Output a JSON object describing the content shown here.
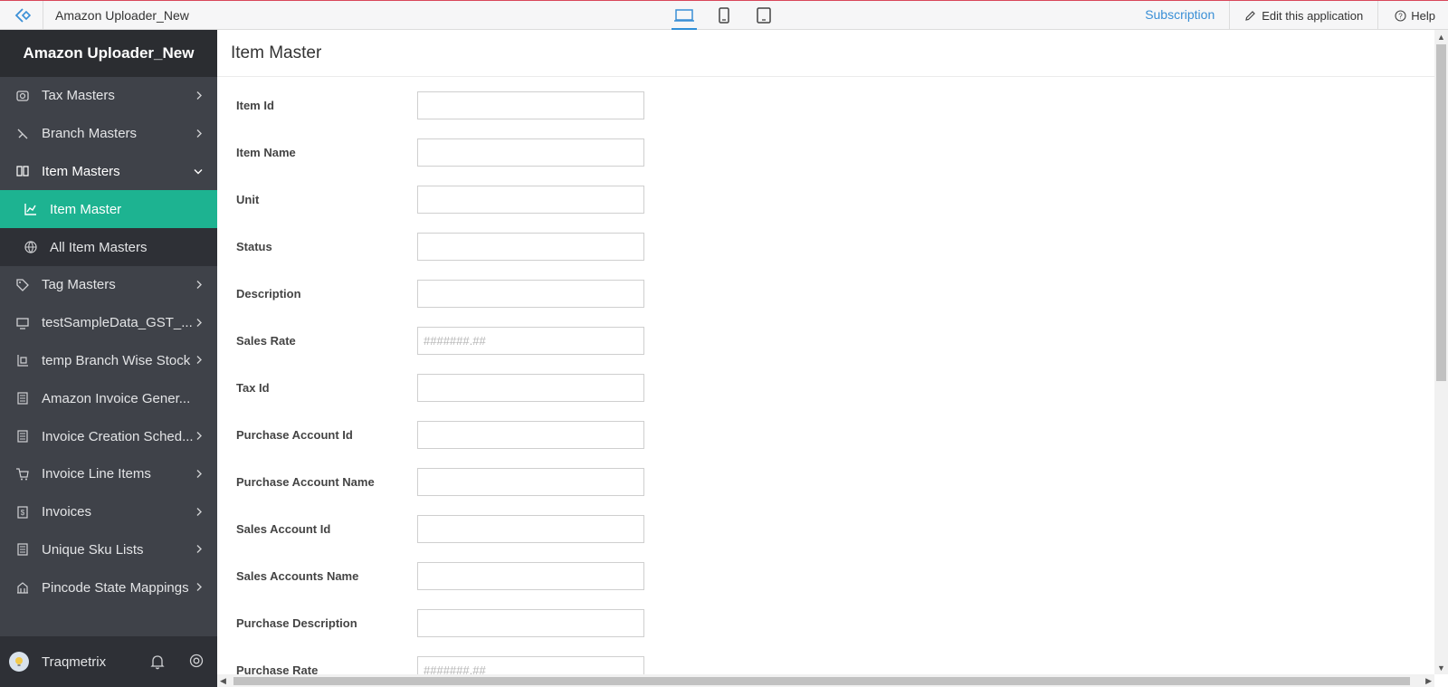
{
  "topbar": {
    "app_title": "Amazon Uploader_New",
    "subscription": "Subscription",
    "edit_app": "Edit this application",
    "help": "Help"
  },
  "sidebar": {
    "header": "Amazon Uploader_New",
    "items": [
      {
        "label": "Tax Masters",
        "icon": "tax-icon"
      },
      {
        "label": "Branch Masters",
        "icon": "branch-icon"
      },
      {
        "label": "Item Masters",
        "icon": "book-icon",
        "expanded": true
      },
      {
        "label": "Tag Masters",
        "icon": "tag-icon"
      },
      {
        "label": "testSampleData_GST_...",
        "icon": "monitor-icon"
      },
      {
        "label": "temp Branch Wise Stock",
        "icon": "stock-icon"
      },
      {
        "label": "Amazon Invoice Gener...",
        "icon": "report-icon"
      },
      {
        "label": "Invoice Creation Sched...",
        "icon": "report-icon"
      },
      {
        "label": "Invoice Line Items",
        "icon": "cart-icon"
      },
      {
        "label": "Invoices",
        "icon": "invoice-icon"
      },
      {
        "label": "Unique Sku Lists",
        "icon": "report-icon"
      },
      {
        "label": "Pincode State Mappings",
        "icon": "building-icon"
      }
    ],
    "subitems": [
      {
        "label": "Item Master",
        "icon": "chart-icon",
        "active": true
      },
      {
        "label": "All Item Masters",
        "icon": "globe-icon"
      }
    ],
    "footer_user": "Traqmetrix"
  },
  "main": {
    "page_title": "Item Master",
    "fields": [
      {
        "label": "Item Id",
        "placeholder": ""
      },
      {
        "label": "Item Name",
        "placeholder": ""
      },
      {
        "label": "Unit",
        "placeholder": ""
      },
      {
        "label": "Status",
        "placeholder": ""
      },
      {
        "label": "Description",
        "placeholder": ""
      },
      {
        "label": "Sales Rate",
        "placeholder": "#######.##"
      },
      {
        "label": "Tax Id",
        "placeholder": ""
      },
      {
        "label": "Purchase Account Id",
        "placeholder": ""
      },
      {
        "label": "Purchase Account Name",
        "placeholder": ""
      },
      {
        "label": "Sales Account Id",
        "placeholder": ""
      },
      {
        "label": "Sales Accounts Name",
        "placeholder": ""
      },
      {
        "label": "Purchase Description",
        "placeholder": ""
      },
      {
        "label": "Purchase Rate",
        "placeholder": "#######.##"
      }
    ]
  },
  "colors": {
    "sidebar_bg": "#3f4249",
    "active_item": "#1db391",
    "link": "#3a8fd6"
  }
}
